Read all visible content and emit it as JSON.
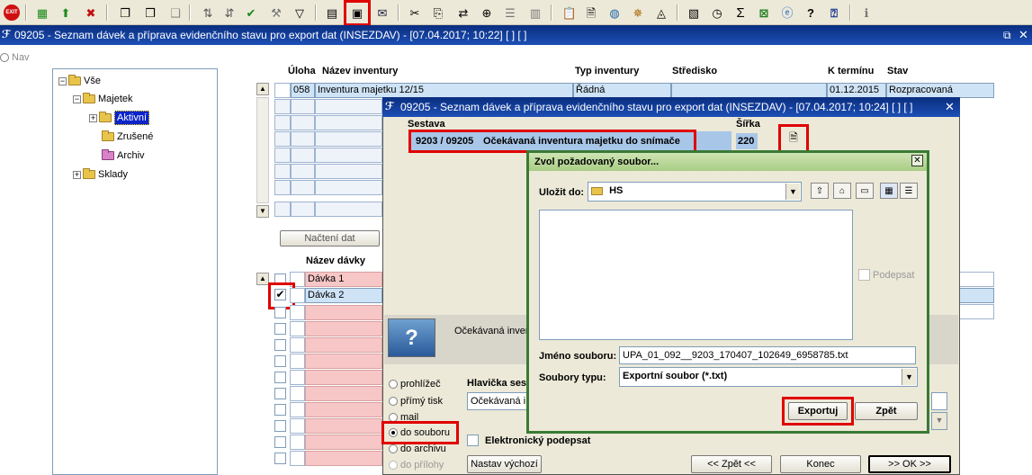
{
  "toolbar": {
    "icons": [
      "exit-icon",
      "add-icon",
      "add-copy-icon",
      "delete-icon",
      "copy-icon",
      "copy-doc-icon",
      "copy-gray-icon",
      "sort-asc-icon",
      "sort-desc-icon",
      "check-icon",
      "wrench-icon",
      "filter-icon",
      "print-icon",
      "print-export-icon",
      "mail-icon",
      "cut-icon",
      "paste-icon",
      "transfer-icon",
      "zoom-icon",
      "list-icon",
      "columns-icon",
      "clipboard-icon",
      "document-icon",
      "globe-icon",
      "wheel-icon",
      "eye-icon",
      "report-icon",
      "clock-icon",
      "sum-icon",
      "excel-icon",
      "ie-icon",
      "help-icon",
      "question-icon",
      "info-icon"
    ],
    "exit_label": "EXIT"
  },
  "main_window": {
    "title": "09205 - Seznam dávek a příprava evidenčního stavu pro export dat (INSEZDAV) - [07.04.2017; 10:22]  [ ]  [ ]",
    "nav_label": "Nav"
  },
  "tree": {
    "items": [
      {
        "label": "Vše"
      },
      {
        "label": "Majetek"
      },
      {
        "label": "Aktivní"
      },
      {
        "label": "Zrušené"
      },
      {
        "label": "Archiv"
      },
      {
        "label": "Sklady"
      }
    ]
  },
  "inventory_grid": {
    "headers": [
      "Úloha",
      "Název inventury",
      "Typ inventury",
      "Středisko",
      "K termínu",
      "Stav"
    ],
    "row": {
      "uloha": "058",
      "nazev": "Inventura majetku 12/15",
      "typ": "Řádná",
      "stredisko": "",
      "termin": "01.12.2015",
      "stav": "Rozpracovaná"
    }
  },
  "load_button": "Načtení dat",
  "batch_grid": {
    "header": "Název dávky",
    "rows": [
      {
        "name": "Dávka 1"
      },
      {
        "name": "Dávka 2"
      }
    ]
  },
  "preview_text": "Očekávaná inven",
  "output_options": {
    "items": [
      {
        "label": "prohlížeč"
      },
      {
        "label": "přímý tisk"
      },
      {
        "label": "mail"
      },
      {
        "label": "do souboru"
      },
      {
        "label": "do archivu"
      },
      {
        "label": "do přílohy"
      }
    ],
    "selected": "do souboru"
  },
  "header_section": {
    "label": "Hlavička ses",
    "value": "Očekávaná i"
  },
  "signature_checkbox": "Elektronický podepsat",
  "bottom_buttons": {
    "reset": "Nastav výchozí",
    "back": "<< Zpět <<",
    "end": "Konec",
    "ok": ">> OK >>"
  },
  "dialog_report": {
    "title": "09205 - Seznam dávek a příprava evidenčního stavu pro export dat (INSEZDAV) - [07.04.2017; 10:24]  [ ]  [ ]",
    "col_sestava": "Sestava",
    "col_sirka": "Šířka",
    "report_code": "9203 / 09205",
    "report_name": "Očekávaná inventura majetku do snímače",
    "width": "220"
  },
  "dialog_file": {
    "title": "Zvol požadovaný soubor...",
    "save_in_label": "Uložit do:",
    "save_in_value": "HS",
    "sign_label": "Podepsat",
    "filename_label": "Jméno souboru:",
    "filename_value": "UPA_01_092__9203_170407_102649_6958785.txt",
    "filetype_label": "Soubory typu:",
    "filetype_value": "Exportní soubor (*.txt)",
    "export_button": "Exportuj",
    "back_button": "Zpět"
  },
  "colors": {
    "title_bar": "#0a2e80",
    "highlight": "#e00000",
    "dialog_border": "#3a7a34",
    "selected_row": "#cfe3f6",
    "pink_row": "#f7c6c6"
  }
}
